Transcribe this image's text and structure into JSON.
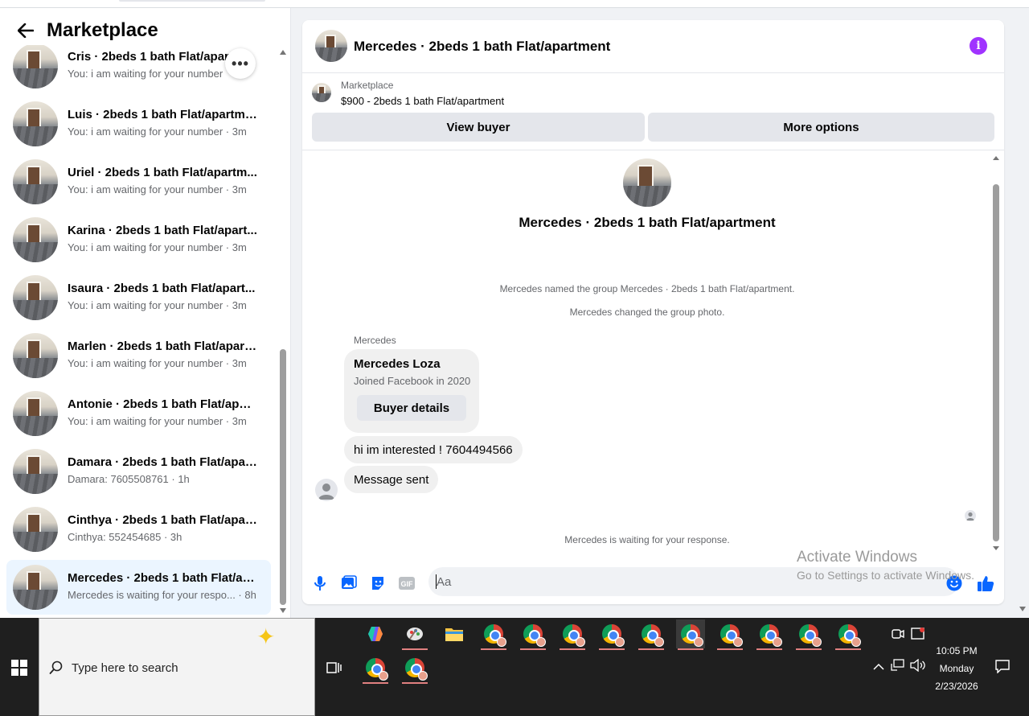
{
  "marketplace": {
    "title": "Marketplace",
    "conversations": [
      {
        "name": "Cris · 2beds 1 bath Flat/apartment",
        "preview": "You: i am waiting for your number"
      },
      {
        "name": "Luis · 2beds 1 bath Flat/apartment",
        "preview": "You: i am waiting for your number · 3m"
      },
      {
        "name": "Uriel · 2beds 1 bath Flat/apartm...",
        "preview": "You: i am waiting for your number · 3m"
      },
      {
        "name": "Karina · 2beds 1 bath Flat/apart...",
        "preview": "You: i am waiting for your number · 3m"
      },
      {
        "name": "Isaura · 2beds 1 bath Flat/apart...",
        "preview": "You: i am waiting for your number · 3m"
      },
      {
        "name": "Marlen · 2beds 1 bath Flat/apart...",
        "preview": "You: i am waiting for your number · 3m"
      },
      {
        "name": "Antonie · 2beds 1 bath Flat/apar...",
        "preview": "You: i am waiting for your number · 3m"
      },
      {
        "name": "Damara · 2beds 1 bath Flat/apar...",
        "preview": "Damara: 7605508761 · 1h"
      },
      {
        "name": "Cinthya · 2beds 1 bath Flat/apart...",
        "preview": "Cinthya: 552454685 · 3h"
      },
      {
        "name": "Mercedes · 2beds 1 bath Flat/ap...",
        "preview": "Mercedes is waiting for your respo... · 8h"
      }
    ]
  },
  "chat": {
    "title": "Mercedes · 2beds 1 bath Flat/apartment",
    "listing": {
      "label": "Marketplace",
      "price_title": "$900 - 2beds 1 bath Flat/apartment",
      "view_buyer": "View buyer",
      "more_options": "More options"
    },
    "group_title": "Mercedes · 2beds 1 bath Flat/apartment",
    "system_messages": [
      "Mercedes named the group Mercedes · 2beds 1 bath Flat/apartment.",
      "Mercedes changed the group photo."
    ],
    "sender": "Mercedes",
    "buyer_card": {
      "name": "Mercedes Loza",
      "joined": "Joined Facebook in 2020",
      "button": "Buyer details"
    },
    "messages": [
      "hi im interested ! 7604494566",
      "Message sent"
    ],
    "waiting": "Mercedes is waiting for your response.",
    "composer_placeholder": "Aa"
  },
  "watermark": {
    "line1": "Activate Windows",
    "line2": "Go to Settings to activate Windows."
  },
  "taskbar": {
    "search_placeholder": "Type here to search",
    "time": "10:05 PM",
    "day": "Monday",
    "date": "2/23/2026"
  },
  "colors": {
    "accent": "#0866ff",
    "info": "#a033ff",
    "active_row": "#ebf5ff"
  }
}
